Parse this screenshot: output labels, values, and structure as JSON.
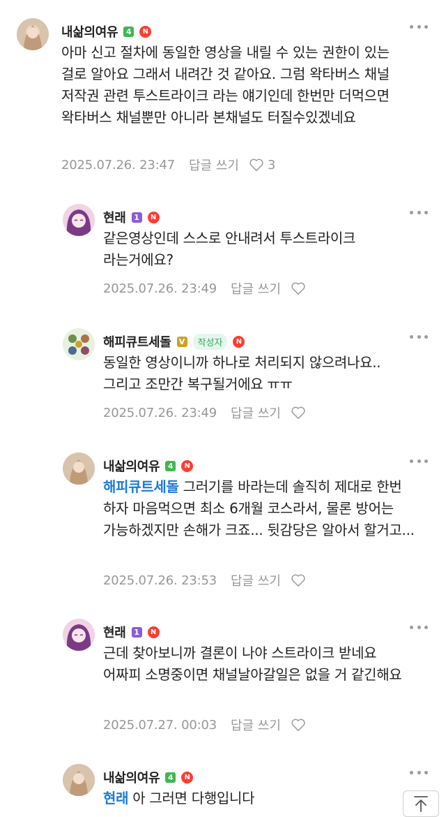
{
  "comments": [
    {
      "nickname": "내삶의여유",
      "level": "4",
      "text": "아마 신고 절차에 동일한 영상을 내릴 수 있는 권한이 있는 걸로 알아요 그래서 내려간 것 같아요. 그럼 왁타버스 채널 저작권 관련 투스트라이크 라는 얘기인데 한번만 더먹으면 왁타버스 채널뿐만 아니라 본채널도 터질수있겠네요",
      "date": "2025.07.26. 23:47",
      "reply_label": "답글 쓰기",
      "like_count": "3"
    },
    {
      "nickname": "현래",
      "level": "1",
      "text": "같은영상인데 스스로 안내려서 투스트라이크 라는거에요?",
      "date": "2025.07.26. 23:49",
      "reply_label": "답글 쓰기"
    },
    {
      "nickname": "해피큐트세돌",
      "level": "V",
      "author_badge": "작성자",
      "text": "동일한 영상이니까 하나로 처리되지 않으려나요.. 그리고 조만간 복구될거에요 ㅠㅠ",
      "date": "2025.07.26. 23:49",
      "reply_label": "답글 쓰기"
    },
    {
      "nickname": "내삶의여유",
      "level": "4",
      "mention": "해피큐트세돌",
      "text": "그러기를 바라는데 솔직히 제대로 한번 하자 마음먹으면 최소 6개월 코스라서, 물론 방어는 가능하겠지만 손해가 크죠... 뒷감당은 알아서 할거고...",
      "date": "2025.07.26. 23:53",
      "reply_label": "답글 쓰기"
    },
    {
      "nickname": "현래",
      "level": "1",
      "text": "근데 찾아보니까 결론이 나야 스트라이크 받네요 어짜피 소명중이면 채널날아갈일은 없을 거 같긴해요",
      "date": "2025.07.27. 00:03",
      "reply_label": "답글 쓰기"
    },
    {
      "nickname": "내삶의여유",
      "level": "4",
      "mention": "현래",
      "text": "아 그러면 다행입니다"
    }
  ],
  "new_badge": "N",
  "colors": {
    "level4": "#3db84f",
    "level1": "#8a5cd6",
    "levelV": "#c9a227",
    "mention": "#1a7ad9"
  }
}
